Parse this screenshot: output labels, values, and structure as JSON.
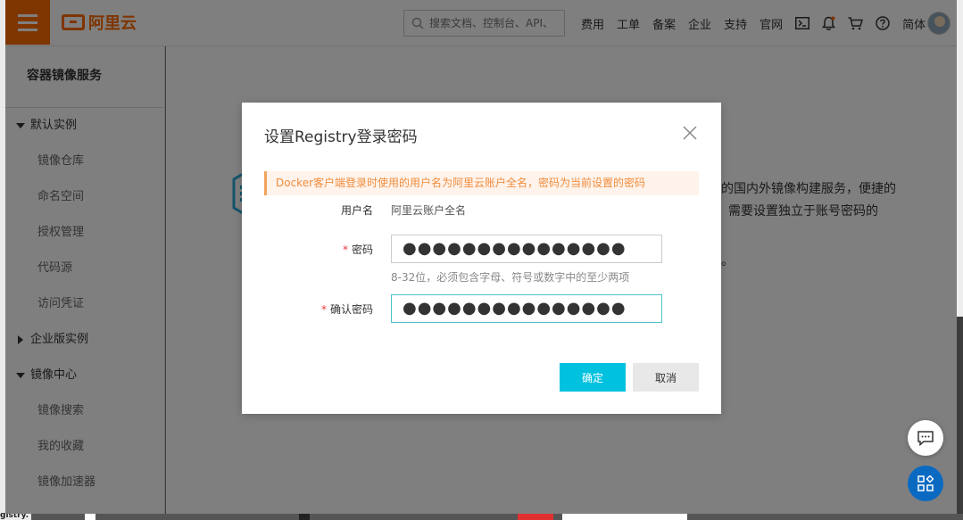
{
  "topbar": {
    "brand": "阿里云",
    "search_placeholder": "搜索文档、控制台、API、",
    "nav": [
      "费用",
      "工单",
      "备案",
      "企业",
      "支持",
      "官网"
    ],
    "lang": "简体"
  },
  "sidebar": {
    "title": "容器镜像服务",
    "groups": [
      {
        "label": "默认实例",
        "items": [
          "镜像仓库",
          "命名空间",
          "授权管理",
          "代码源",
          "访问凭证"
        ]
      },
      {
        "label": "企业版实例",
        "items": []
      },
      {
        "label": "镜像中心",
        "items": [
          "镜像搜索",
          "我的收藏",
          "镜像加速器"
        ]
      }
    ]
  },
  "main": {
    "line1": "的国内外镜像构建服务，便捷的",
    "line2": "需要设置独立于账号密码的",
    "line3": "。"
  },
  "dialog": {
    "title": "设置Registry登录密码",
    "notice": "Docker客户端登录时使用的用户名为阿里云账户全名，密码为当前设置的密码",
    "username_label": "用户名",
    "username_value": "阿里云账户全名",
    "password_label": "密码",
    "password_value": "●●●●●●●●●●●●●●●",
    "password_hint": "8-32位，必须包含字母、符号或数字中的至少两项",
    "confirm_label": "确认密码",
    "confirm_value": "●●●●●●●●●●●●●●●",
    "ok_label": "确定",
    "cancel_label": "取消",
    "required_mark": "*"
  },
  "background": {
    "bottom_text": "gistry."
  },
  "colors": {
    "brand": "#ff6a00",
    "primary": "#00c1de",
    "notice_bg": "#fff3eb",
    "notice_text": "#f08c3c",
    "required": "#e4393c",
    "focus_border": "#4bc2cc",
    "float_apps": "#0a6ac2"
  },
  "icons": [
    "menu-icon",
    "aliyun-logo-icon",
    "search-icon",
    "terminal-icon",
    "bell-icon",
    "cart-icon",
    "help-icon",
    "avatar",
    "close-icon",
    "chat-icon",
    "apps-icon",
    "hexagon-logo-icon"
  ]
}
